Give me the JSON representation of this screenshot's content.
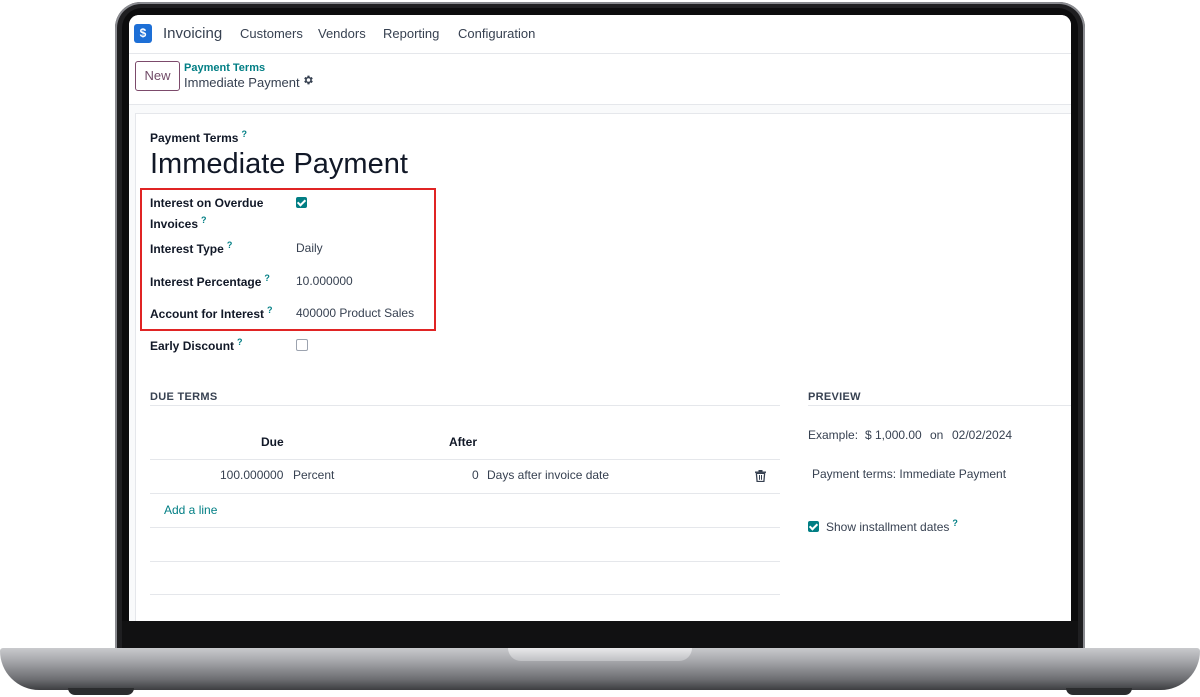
{
  "app": {
    "logo_glyph": "$",
    "name": "Invoicing",
    "accent": "#017e84",
    "brand": "#714b67"
  },
  "menu": [
    "Customers",
    "Vendors",
    "Reporting",
    "Configuration"
  ],
  "control_panel": {
    "new_label": "New",
    "breadcrumb_parent": "Payment Terms",
    "breadcrumb_current": "Immediate Payment",
    "gear_icon": "gear-icon"
  },
  "form": {
    "name_label": "Payment Terms",
    "name_value": "Immediate Payment",
    "help_mark": "?",
    "interest_overdue_label_1": "Interest on Overdue",
    "interest_overdue_label_2": "Invoices",
    "interest_overdue_checked": true,
    "interest_type_label": "Interest Type",
    "interest_type_value": "Daily",
    "interest_pct_label": "Interest Percentage",
    "interest_pct_value": "10.000000",
    "interest_account_label": "Account for Interest",
    "interest_account_value": "400000 Product Sales",
    "early_discount_label": "Early Discount",
    "early_discount_checked": false
  },
  "due_terms": {
    "title": "DUE TERMS",
    "col_due": "Due",
    "col_after": "After",
    "rows": [
      {
        "due": "100.000000",
        "unit": "Percent",
        "after": "0",
        "after_type": "Days after invoice date"
      }
    ],
    "add_line": "Add a line"
  },
  "preview": {
    "title": "PREVIEW",
    "example_prefix": "Example:",
    "amount": "$ 1,000.00",
    "on": "on",
    "date": "02/02/2024",
    "payment_terms_line": "Payment terms: Immediate Payment",
    "show_installments_label": "Show installment dates",
    "show_installments_checked": true
  }
}
